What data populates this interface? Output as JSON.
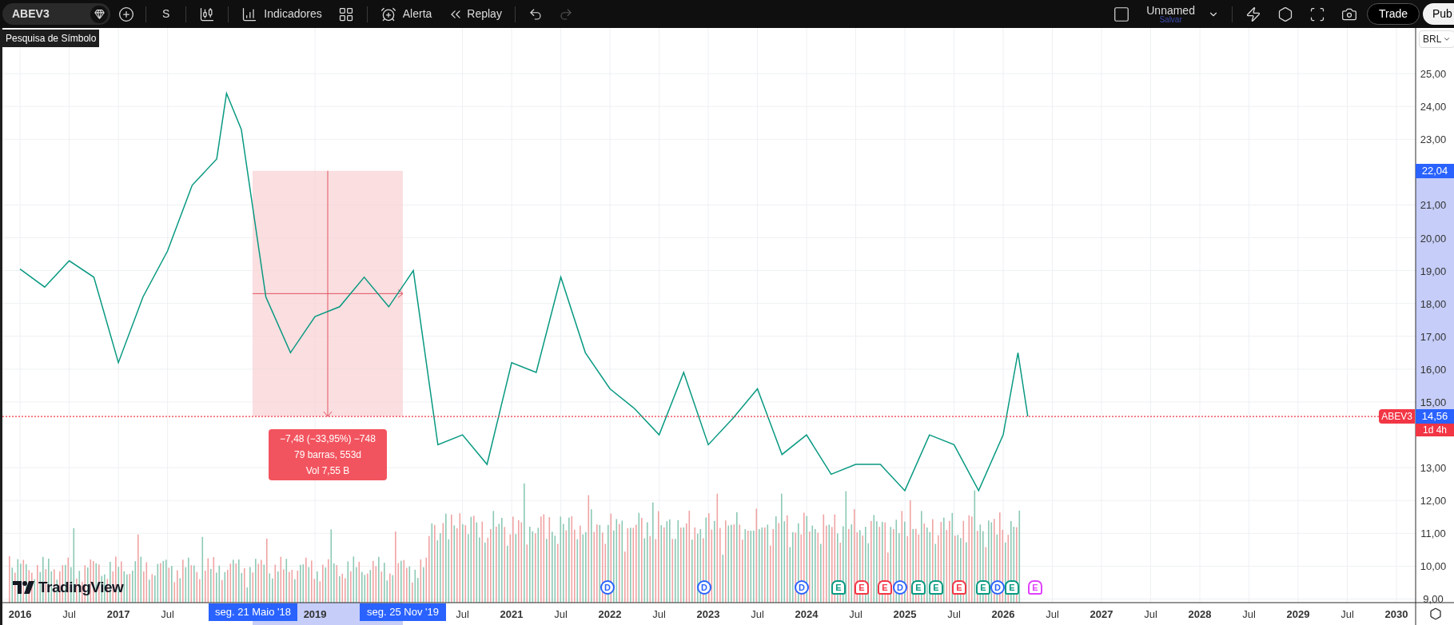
{
  "toolbar": {
    "symbol": "ABEV3",
    "symbol_tooltip": "Pesquisa de Símbolo",
    "interval": "S",
    "indicators": "Indicadores",
    "alert": "Alerta",
    "replay": "Replay",
    "undo_disabled": false,
    "redo_disabled": true,
    "layout_name": "Unnamed",
    "save": "Salvar",
    "trade": "Trade",
    "publish": "Pub"
  },
  "chart": {
    "currency": "BRL",
    "chart_data": {
      "type": "line",
      "x": [
        2016,
        2016.25,
        2016.5,
        2016.75,
        2017,
        2017.25,
        2017.5,
        2017.75,
        2018,
        2018.1,
        2018.25,
        2018.5,
        2018.75,
        2019,
        2019.25,
        2019.5,
        2019.75,
        2020,
        2020.25,
        2020.5,
        2020.75,
        2021,
        2021.25,
        2021.5,
        2021.75,
        2022,
        2022.25,
        2022.5,
        2022.75,
        2023,
        2023.25,
        2023.5,
        2023.75,
        2024,
        2024.25,
        2024.5,
        2024.75,
        2025,
        2025.25,
        2025.5,
        2025.75,
        2026,
        2026.15,
        2026.25
      ],
      "series": [
        {
          "color": "#089981",
          "values": [
            19.05,
            18.5,
            19.3,
            18.8,
            16.2,
            18.2,
            19.6,
            21.6,
            22.4,
            24.4,
            23.3,
            18.2,
            16.5,
            17.6,
            17.9,
            18.8,
            17.9,
            19.0,
            13.7,
            14.0,
            13.1,
            16.2,
            15.9,
            18.8,
            16.5,
            15.4,
            14.8,
            14.0,
            15.9,
            13.7,
            14.5,
            15.4,
            13.4,
            14.0,
            12.8,
            13.1,
            13.1,
            12.3,
            14.0,
            13.7,
            12.3,
            14.0,
            16.5,
            14.56
          ]
        }
      ],
      "xlim": [
        2015.82,
        2030.61
      ],
      "ylim": [
        8.89,
        26.39
      ],
      "grid": true,
      "ref_lines": [
        {
          "axis": "y",
          "value": 14.56,
          "label": "14,56",
          "color": "#f23645"
        }
      ],
      "xticks": [
        {
          "value": 2016,
          "label": "2016"
        },
        {
          "value": 2016.5,
          "label": "Jul"
        },
        {
          "value": 2017,
          "label": "2017"
        },
        {
          "value": 2017.5,
          "label": "Jul"
        },
        {
          "value": 2019,
          "label": "2019"
        },
        {
          "value": 2020.5,
          "label": "Jul"
        },
        {
          "value": 2021,
          "label": "2021"
        },
        {
          "value": 2021.5,
          "label": "Jul"
        },
        {
          "value": 2022,
          "label": "2022"
        },
        {
          "value": 2022.5,
          "label": "Jul"
        },
        {
          "value": 2023,
          "label": "2023"
        },
        {
          "value": 2023.5,
          "label": "Jul"
        },
        {
          "value": 2024,
          "label": "2024"
        },
        {
          "value": 2024.5,
          "label": "Jul"
        },
        {
          "value": 2025,
          "label": "2025"
        },
        {
          "value": 2025.5,
          "label": "Jul"
        },
        {
          "value": 2026,
          "label": "2026"
        },
        {
          "value": 2026.5,
          "label": "Jul"
        },
        {
          "value": 2027,
          "label": "2027"
        },
        {
          "value": 2027.5,
          "label": "Jul"
        },
        {
          "value": 2028,
          "label": "2028"
        },
        {
          "value": 2028.5,
          "label": "Jul"
        },
        {
          "value": 2029,
          "label": "2029"
        },
        {
          "value": 2029.5,
          "label": "Jul"
        },
        {
          "value": 2030,
          "label": "2030"
        }
      ],
      "yticks": [
        {
          "value": 25,
          "label": "25,00"
        },
        {
          "value": 24,
          "label": "24,00"
        },
        {
          "value": 23,
          "label": "23,00"
        },
        {
          "value": 21,
          "label": "21,00"
        },
        {
          "value": 20,
          "label": "20,00"
        },
        {
          "value": 19,
          "label": "19,00"
        },
        {
          "value": 18,
          "label": "18,00"
        },
        {
          "value": 17,
          "label": "17,00"
        },
        {
          "value": 16,
          "label": "16,00"
        },
        {
          "value": 15,
          "label": "15,00"
        },
        {
          "value": 13,
          "label": "13,00"
        },
        {
          "value": 12,
          "label": "12,00"
        },
        {
          "value": 11,
          "label": "11,00"
        },
        {
          "value": 10,
          "label": "10,00"
        },
        {
          "value": 9,
          "label": "9,00"
        }
      ]
    },
    "measure": {
      "change": "−7,48 (−33,95%) −748",
      "bars": "79 barras, 553d",
      "volume": "Vol 7,55 B",
      "top_price": "22,04",
      "start_date": "seg. 21 Maio '18",
      "end_date": "seg. 25 Nov '19"
    },
    "last_price": {
      "symbol": "ABEV3",
      "countdown": "1d 4h"
    },
    "events": [
      {
        "kind": "dividend",
        "label": "D",
        "color": "#2962ff"
      },
      {
        "kind": "dividend",
        "label": "D",
        "color": "#2962ff"
      },
      {
        "kind": "dividend",
        "label": "D",
        "color": "#2962ff"
      },
      {
        "kind": "earnings",
        "label": "E",
        "color": "#089981"
      },
      {
        "kind": "earnings",
        "label": "E",
        "color": "#f23645"
      },
      {
        "kind": "earnings",
        "label": "E",
        "color": "#f23645"
      },
      {
        "kind": "dividend",
        "label": "D",
        "color": "#2962ff"
      },
      {
        "kind": "earnings",
        "label": "E",
        "color": "#089981"
      },
      {
        "kind": "earnings",
        "label": "E",
        "color": "#089981"
      },
      {
        "kind": "earnings",
        "label": "E",
        "color": "#f23645"
      },
      {
        "kind": "earnings",
        "label": "E",
        "color": "#089981"
      },
      {
        "kind": "dividend",
        "label": "D",
        "color": "#2962ff"
      },
      {
        "kind": "earnings",
        "label": "E",
        "color": "#089981"
      },
      {
        "kind": "earnings",
        "label": "E",
        "color": "#e040fb"
      }
    ],
    "logo": "TradingView"
  }
}
